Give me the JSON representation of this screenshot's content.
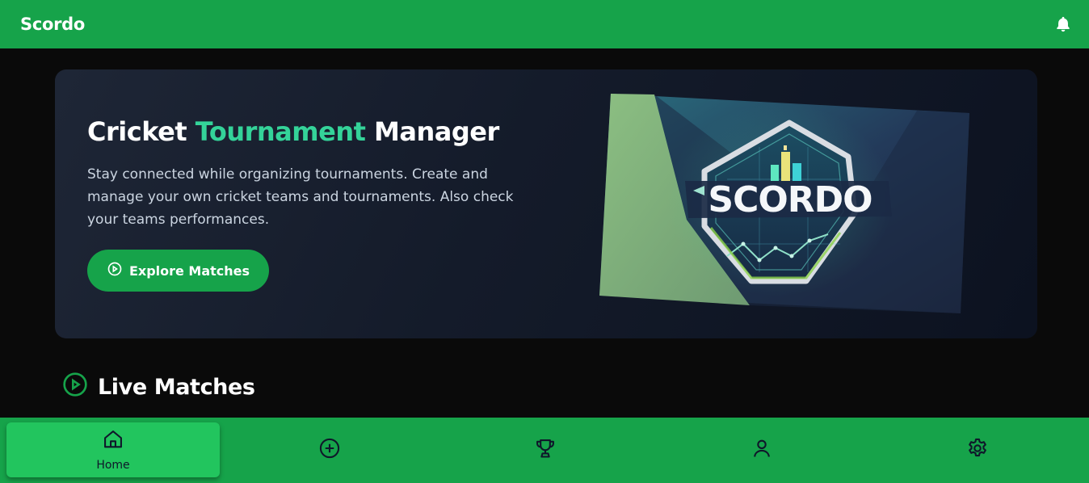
{
  "app": {
    "title": "Scordo"
  },
  "hero": {
    "title_part1": "Cricket",
    "title_accent": "Tournament",
    "title_part2": "Manager",
    "description": "Stay connected while organizing tournaments. Create and manage your own cricket teams and tournaments. Also check your teams performances.",
    "cta_label": "Explore Matches",
    "logo_text": "SCORDO"
  },
  "sections": {
    "live_matches": "Live Matches"
  },
  "nav": {
    "items": [
      {
        "label": "Home",
        "icon": "home-icon",
        "active": true
      },
      {
        "label": "",
        "icon": "plus-circle-icon",
        "active": false
      },
      {
        "label": "",
        "icon": "trophy-icon",
        "active": false
      },
      {
        "label": "",
        "icon": "user-icon",
        "active": false
      },
      {
        "label": "",
        "icon": "gear-icon",
        "active": false
      }
    ]
  },
  "colors": {
    "primary": "#16a34a",
    "active_nav": "#22c55e",
    "accent_text": "#34d399",
    "background": "#0a0a0a"
  }
}
